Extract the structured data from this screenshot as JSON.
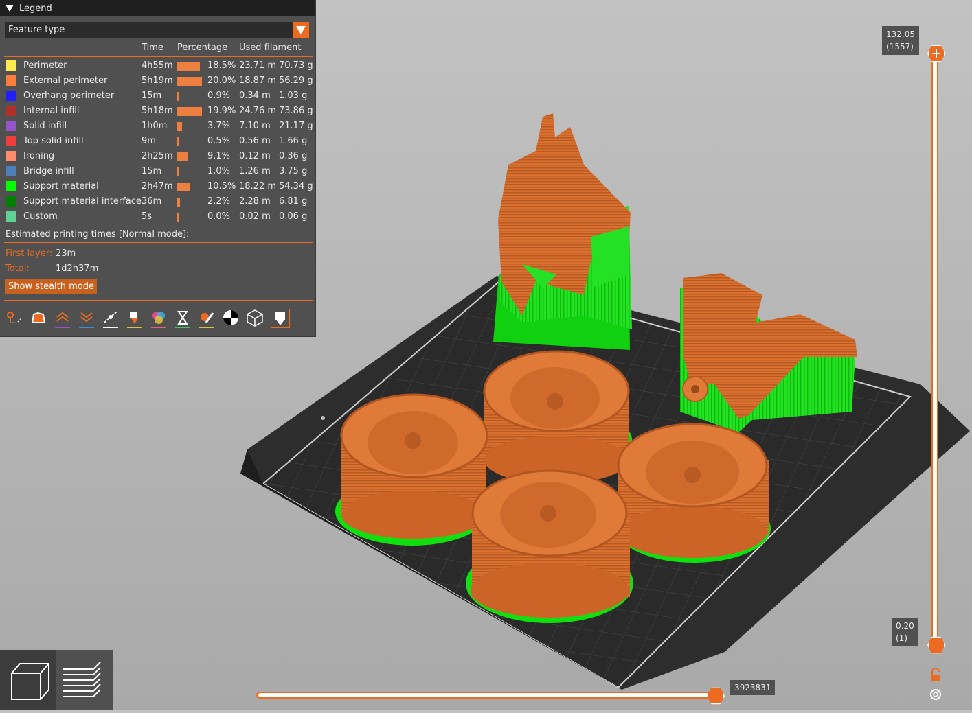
{
  "legend": {
    "title": "Legend",
    "view_type": "Feature type",
    "headers": {
      "time": "Time",
      "percentage": "Percentage",
      "filament": "Used filament"
    },
    "rows": [
      {
        "name": "Perimeter",
        "color": "#FFE94D",
        "time": "4h55m",
        "pct": "18.5%",
        "length": "23.71 m",
        "weight": "70.73 g",
        "fraction": 0.185
      },
      {
        "name": "External perimeter",
        "color": "#FF7D38",
        "time": "5h19m",
        "pct": "20.0%",
        "length": "18.87 m",
        "weight": "56.29 g",
        "fraction": 0.2
      },
      {
        "name": "Overhang perimeter",
        "color": "#1F1FFF",
        "time": "15m",
        "pct": "0.9%",
        "length": "0.34 m",
        "weight": "1.03 g",
        "fraction": 0.009
      },
      {
        "name": "Internal infill",
        "color": "#B03029",
        "time": "5h18m",
        "pct": "19.9%",
        "length": "24.76 m",
        "weight": "73.86 g",
        "fraction": 0.199
      },
      {
        "name": "Solid infill",
        "color": "#9654CC",
        "time": "1h0m",
        "pct": "3.7%",
        "length": "7.10 m",
        "weight": "21.17 g",
        "fraction": 0.037
      },
      {
        "name": "Top solid infill",
        "color": "#F03C3C",
        "time": "9m",
        "pct": "0.5%",
        "length": "0.56 m",
        "weight": "1.66 g",
        "fraction": 0.005
      },
      {
        "name": "Ironing",
        "color": "#FF8C69",
        "time": "2h25m",
        "pct": "9.1%",
        "length": "0.12 m",
        "weight": "0.36 g",
        "fraction": 0.091
      },
      {
        "name": "Bridge infill",
        "color": "#4D80BA",
        "time": "15m",
        "pct": "1.0%",
        "length": "1.26 m",
        "weight": "3.75 g",
        "fraction": 0.01
      },
      {
        "name": "Support material",
        "color": "#00FF00",
        "time": "2h47m",
        "pct": "10.5%",
        "length": "18.22 m",
        "weight": "54.34 g",
        "fraction": 0.105
      },
      {
        "name": "Support material interface",
        "color": "#008000",
        "time": "36m",
        "pct": "2.2%",
        "length": "2.28 m",
        "weight": "6.81 g",
        "fraction": 0.022
      },
      {
        "name": "Custom",
        "color": "#5ED194",
        "time": "5s",
        "pct": "0.0%",
        "length": "0.02 m",
        "weight": "0.06 g",
        "fraction": 0.0
      }
    ],
    "estimated_label": "Estimated printing times [Normal mode]:",
    "first_layer_label": "First layer:",
    "first_layer_value": "23m",
    "total_label": "Total:",
    "total_value": "1d2h37m",
    "stealth_button": "Show stealth mode",
    "toolbar": [
      {
        "icon": "travel-icon",
        "underline": ""
      },
      {
        "icon": "wipe-icon",
        "underline": ""
      },
      {
        "icon": "retractions-icon",
        "underline": "#a14bd1"
      },
      {
        "icon": "deretractions-icon",
        "underline": "#3d8fd1"
      },
      {
        "icon": "seams-icon",
        "underline": "#ffffff"
      },
      {
        "icon": "tool-changes-icon",
        "underline": "#e0c23e"
      },
      {
        "icon": "color-changes-icon",
        "underline": "#e0607e"
      },
      {
        "icon": "pause-prints-icon",
        "underline": "#3ec25f"
      },
      {
        "icon": "custom-gcodes-icon",
        "underline": "#e0c23e"
      },
      {
        "icon": "center-of-gravity-icon",
        "underline": ""
      },
      {
        "icon": "shells-icon",
        "underline": ""
      },
      {
        "icon": "tool-marker-icon",
        "underline": ""
      }
    ]
  },
  "vertical_slider": {
    "top_height": "132.05",
    "top_layer": "(1557)",
    "bottom_height": "0.20",
    "bottom_layer": "(1)"
  },
  "horizontal_slider": {
    "value": "3923831"
  },
  "colors": {
    "accent": "#ed6b21",
    "model": "#e0742f",
    "support": "#10ef10"
  }
}
